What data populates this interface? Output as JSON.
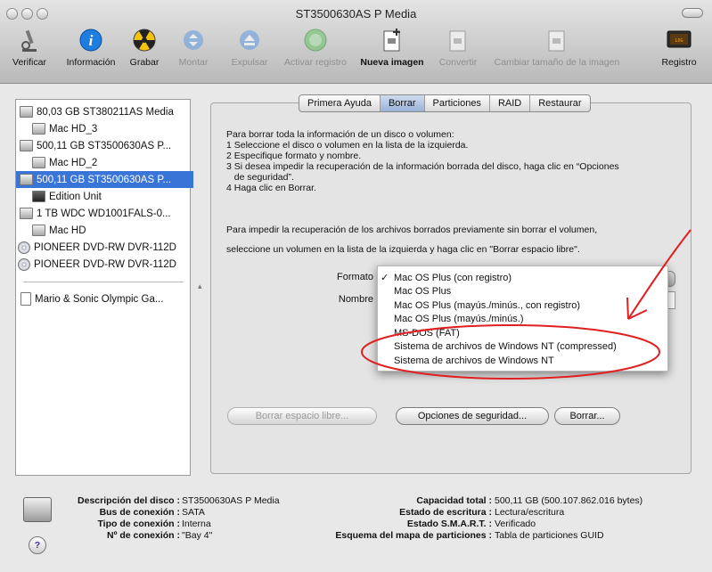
{
  "window": {
    "title": "ST3500630AS P Media"
  },
  "toolbar": [
    {
      "label": "Verificar",
      "icon": "microscope-icon",
      "enabled": true
    },
    {
      "label": "Información",
      "icon": "info-icon",
      "enabled": true
    },
    {
      "label": "Grabar",
      "icon": "burn-icon",
      "enabled": true
    },
    {
      "label": "Montar",
      "icon": "mount-icon",
      "enabled": false
    },
    {
      "label": "Expulsar",
      "icon": "eject-icon",
      "enabled": false
    },
    {
      "label": "Activar registro",
      "icon": "journal-icon",
      "enabled": false
    },
    {
      "label": "Nueva imagen",
      "icon": "new-image-icon",
      "enabled": true
    },
    {
      "label": "Convertir",
      "icon": "convert-icon",
      "enabled": false
    },
    {
      "label": "Cambiar tamaño de la imagen",
      "icon": "resize-image-icon",
      "enabled": false
    },
    {
      "label": "Registro",
      "icon": "log-icon",
      "enabled": true
    }
  ],
  "sidebar": {
    "items": [
      {
        "label": "80,03 GB ST380211AS Media",
        "kind": "disk",
        "indent": 0
      },
      {
        "label": "Mac HD_3",
        "kind": "volume",
        "indent": 1
      },
      {
        "label": "500,11 GB ST3500630AS P...",
        "kind": "disk",
        "indent": 0
      },
      {
        "label": "Mac HD_2",
        "kind": "volume",
        "indent": 1
      },
      {
        "label": "500,11 GB ST3500630AS P...",
        "kind": "disk",
        "indent": 0,
        "selected": true
      },
      {
        "label": "Edition Unit",
        "kind": "volume",
        "indent": 1
      },
      {
        "label": "1 TB WDC WD1001FALS-0...",
        "kind": "disk",
        "indent": 0
      },
      {
        "label": "Mac HD",
        "kind": "volume",
        "indent": 1
      },
      {
        "label": "PIONEER DVD-RW DVR-112D",
        "kind": "cd",
        "indent": 0
      },
      {
        "label": "PIONEER DVD-RW DVR-112D",
        "kind": "cd",
        "indent": 0
      }
    ],
    "images": [
      {
        "label": "Mario & Sonic Olympic Ga...",
        "kind": "doc"
      }
    ]
  },
  "tabs": [
    {
      "label": "Primera Ayuda",
      "active": false
    },
    {
      "label": "Borrar",
      "active": true
    },
    {
      "label": "Particiones",
      "active": false
    },
    {
      "label": "RAID",
      "active": false
    },
    {
      "label": "Restaurar",
      "active": false
    }
  ],
  "erase": {
    "instructions": [
      "Para borrar toda la información de un disco o volumen:",
      "1 Seleccione el disco o volumen en la lista de la izquierda.",
      "2 Especifique formato y nombre.",
      "3 Si desea impedir la recuperación de la información borrada del disco, haga clic en “Opciones",
      "   de seguridad”.",
      "4 Haga clic en Borrar."
    ],
    "instructions2": [
      "Para impedir la recuperación de los archivos borrados previamente sin borrar el volumen,",
      "seleccione un volumen en la lista de la izquierda y haga clic en \"Borrar espacio libre\"."
    ],
    "format_label": "Formato",
    "name_label": "Nombre",
    "format_options": [
      "Mac OS Plus (con registro)",
      "Mac OS Plus",
      "Mac OS Plus (mayús./minús., con registro)",
      "Mac OS Plus (mayús./minús.)",
      "MS-DOS (FAT)",
      "Sistema de archivos de Windows NT (compressed)",
      "Sistema de archivos de Windows NT"
    ],
    "selected_format": "Mac OS Plus (con registro)",
    "erase_free_space_button": "Borrar espacio libre...",
    "security_options_button": "Opciones de seguridad...",
    "erase_button": "Borrar..."
  },
  "info": {
    "left": [
      {
        "k": "Descripción del disco :",
        "v": "ST3500630AS P Media"
      },
      {
        "k": "Bus de conexión :",
        "v": "SATA"
      },
      {
        "k": "Tipo de conexión :",
        "v": "Interna"
      },
      {
        "k": "Nº de conexión :",
        "v": "\"Bay 4\""
      }
    ],
    "right": [
      {
        "k": "Capacidad total :",
        "v": "500,11 GB (500.107.862.016 bytes)"
      },
      {
        "k": "Estado de escritura :",
        "v": "Lectura/escritura"
      },
      {
        "k": "Estado S.M.A.R.T. :",
        "v": "Verificado"
      },
      {
        "k": "Esquema del mapa de particiones :",
        "v": "Tabla de particiones GUID"
      }
    ],
    "help": "?"
  },
  "colors": {
    "selection": "#3875d7",
    "annotation": "#e02020"
  }
}
